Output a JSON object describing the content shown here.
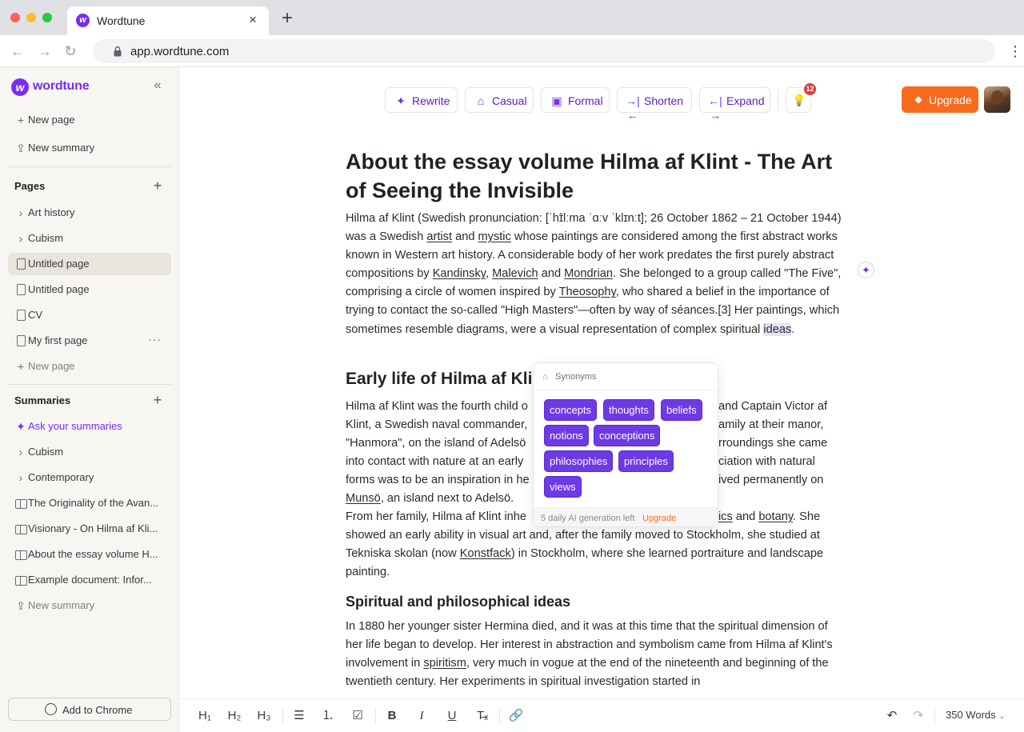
{
  "browser": {
    "tab_title": "Wordtune",
    "url": "app.wordtune.com"
  },
  "sidebar": {
    "logo": "wordtune",
    "top_items": [
      {
        "label": "New page",
        "icon": "plus-icon"
      },
      {
        "label": "New summary",
        "icon": "upload-icon"
      }
    ],
    "pages_heading": "Pages",
    "pages": [
      {
        "label": "Art history",
        "icon": "chevron-right-icon"
      },
      {
        "label": "Cubism",
        "icon": "chevron-right-icon"
      },
      {
        "label": "Untitled page",
        "icon": "document-icon",
        "active": true
      },
      {
        "label": "Untitled page",
        "icon": "document-icon"
      },
      {
        "label": "CV",
        "icon": "document-icon"
      },
      {
        "label": "My first page",
        "icon": "document-icon"
      },
      {
        "label": "New page",
        "icon": "plus-icon"
      }
    ],
    "summaries_heading": "Summaries",
    "summaries": [
      {
        "label": "Ask your summaries",
        "icon": "sparkle-icon"
      },
      {
        "label": "Cubism",
        "icon": "chevron-right-icon"
      },
      {
        "label": "Contemporary",
        "icon": "chevron-right-icon"
      },
      {
        "label": "The Originality of the Avan...",
        "icon": "book-icon"
      },
      {
        "label": "Visionary - On Hilma af Kli...",
        "icon": "book-icon"
      },
      {
        "label": "About the essay volume H...",
        "icon": "book-icon"
      },
      {
        "label": "Example document: Infor...",
        "icon": "book-icon"
      },
      {
        "label": "New summary",
        "icon": "upload-icon"
      }
    ],
    "add_to_chrome": "Add to Chrome"
  },
  "toolbar": {
    "rewrite": "Rewrite",
    "casual": "Casual",
    "formal": "Formal",
    "shorten": "Shorten",
    "expand": "Expand",
    "notifications": "12",
    "upgrade": "Upgrade"
  },
  "document": {
    "title": "About the essay volume Hilma af Klint - The Art of Seeing the Invisible",
    "p1": {
      "a": "Hilma af Klint (Swedish pronunciation: [ˈhɪ̂lːma ˈɑːv ˈklɪnːt]; 26 October 1862 – 21 October 1944) was a Swedish ",
      "artist": "artist",
      "b": " and ",
      "mystic": "mystic",
      "c": " whose paintings are considered among the first abstract works known in Western art history. A considerable body of her work predates the first purely abstract compositions by ",
      "kandinsky": "Kandinsky",
      "d": ", ",
      "malevich": "Malevich",
      "e": " and ",
      "mondrian": "Mondrian",
      "f": ". She belonged to a group called \"The Five\", comprising a circle of women inspired by ",
      "theosophy": "Theosophy",
      "g": ", who shared a belief in the importance of trying to contact the so-called \"High Masters\"—often by way of séances.[3] Her paintings, which sometimes resemble diagrams, were a visual representation of complex spiritual ",
      "ideas": "ideas",
      "h": "."
    },
    "h2_early": "Early life of Hilma af Kli",
    "p2_lines": [
      "Hilma af Klint was the fourth child o",
      "and Captain Victor af",
      "Klint, a Swedish naval commander,",
      "amily at their manor,",
      "\"Hanmora\", on the island of Adelsö",
      "rroundings she came",
      "into contact with nature at an early",
      "ciation with natural",
      "forms was to be an inspiration in he",
      "ived permanently on"
    ],
    "p2_munso": "Munsö",
    "p2_tail": ", an island next to Adelsö.",
    "p3_line1_a": "From her family, Hilma af Klint inhe",
    "p3_line1_ics": "ics",
    "p3_line1_b": " and ",
    "p3_line1_botany": "botany",
    "p3_line1_c": ". She",
    "p3_rest_a": "showed an early ability in visual art and, after the family moved to Stockholm, she studied at Tekniska skolan (now ",
    "p3_konstfack": "Konstfack",
    "p3_rest_b": ") in Stockholm, where she learned portraiture and landscape painting.",
    "h3_spiritual": "Spiritual and philosophical ideas",
    "p4_a": "In 1880 her younger sister Hermina died, and it was at this time that the spiritual dimension of her life began to develop. Her interest in abstraction and symbolism came from Hilma af Klint's involvement in ",
    "p4_spiritism": "spiritism",
    "p4_b": ", very much in vogue at the end of the nineteenth and beginning of the twentieth century. Her experiments in spiritual investigation started in"
  },
  "synonyms_popup": {
    "heading": "Synonyms",
    "chips": [
      "concepts",
      "thoughts",
      "beliefs",
      "notions",
      "conceptions",
      "philosophies",
      "principles",
      "views"
    ],
    "footer": "5 daily AI generation left",
    "upgrade": "Upgrade"
  },
  "format_bar": {
    "h1": "H₁",
    "h2": "H₂",
    "h3": "H₃",
    "word_count": "350 Words"
  },
  "colors": {
    "brand": "#7b2cf0",
    "upgrade": "#f86b1e",
    "chip": "#6d3ae6"
  }
}
